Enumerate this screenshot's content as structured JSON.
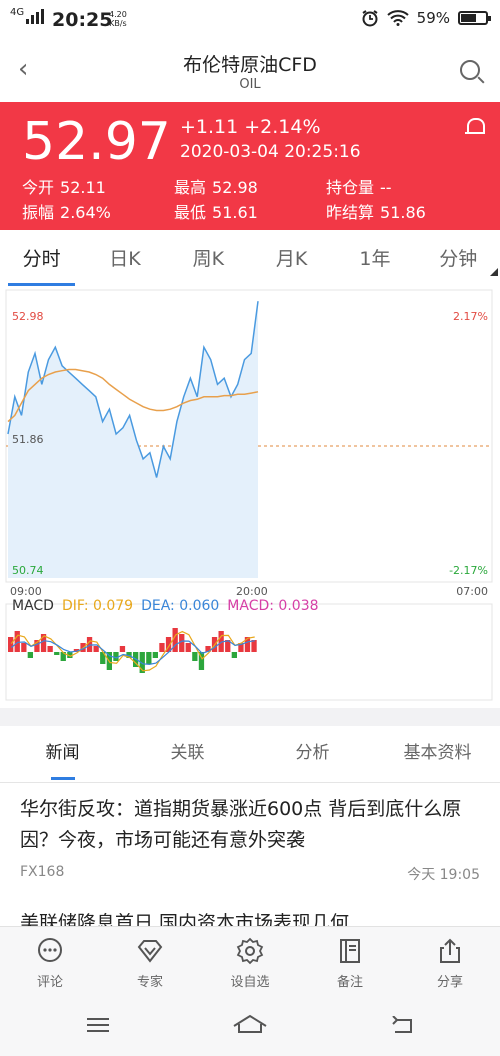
{
  "status_bar": {
    "network": "4G",
    "time": "20:25",
    "speed_value": "4.20",
    "speed_unit": "KB/s",
    "battery": "59%"
  },
  "header": {
    "title": "布伦特原油CFD",
    "subtitle": "OIL"
  },
  "quote": {
    "price": "52.97",
    "change": "+1.11 +2.14%",
    "datetime": "2020-03-04 20:25:16",
    "stats": [
      [
        {
          "label": "今开",
          "value": "52.11"
        },
        {
          "label": "最高",
          "value": "52.98"
        },
        {
          "label": "持仓量",
          "value": "--"
        }
      ],
      [
        {
          "label": "振幅",
          "value": "2.64%"
        },
        {
          "label": "最低",
          "value": "51.61"
        },
        {
          "label": "昨结算",
          "value": "51.86"
        }
      ]
    ],
    "up_color": "#f23846"
  },
  "period_tabs": [
    "分时",
    "日K",
    "周K",
    "月K",
    "1年",
    "分钟"
  ],
  "active_period": 0,
  "chart": {
    "price_top": "52.98",
    "price_mid": "51.86",
    "price_bottom": "50.74",
    "pct_top": "2.17%",
    "pct_bottom": "-2.17%",
    "time_start": "09:00",
    "time_mid": "20:00",
    "time_end": "07:00",
    "macd_title": "MACD",
    "dif": "DIF: 0.079",
    "dea": "DEA: 0.060",
    "macd": "MACD: 0.038",
    "line_color": "#4a9ae0",
    "avg_color": "#e8a04c"
  },
  "chart_data": {
    "type": "line",
    "ylim": [
      50.74,
      52.98
    ],
    "price": [
      51.9,
      52.2,
      52.05,
      52.4,
      52.55,
      52.3,
      52.5,
      52.6,
      52.45,
      52.4,
      52.35,
      52.3,
      52.25,
      52.2,
      52.0,
      52.1,
      51.9,
      51.95,
      52.05,
      51.85,
      51.7,
      51.75,
      51.55,
      51.8,
      51.7,
      52.0,
      52.2,
      52.35,
      52.2,
      52.6,
      52.5,
      52.3,
      52.35,
      52.2,
      52.3,
      52.5,
      52.55,
      52.97
    ],
    "average": [
      52.0,
      52.05,
      52.15,
      52.25,
      52.3,
      52.35,
      52.38,
      52.4,
      52.41,
      52.42,
      52.42,
      52.41,
      52.4,
      52.38,
      52.35,
      52.3,
      52.26,
      52.22,
      52.18,
      52.15,
      52.12,
      52.1,
      52.09,
      52.09,
      52.1,
      52.12,
      52.15,
      52.17,
      52.18,
      52.2,
      52.2,
      52.2,
      52.21,
      52.21,
      52.22,
      52.22,
      52.23,
      52.24
    ],
    "macd_hist": [
      0.05,
      0.07,
      0.03,
      -0.02,
      0.04,
      0.06,
      0.02,
      -0.01,
      -0.03,
      -0.02,
      0.01,
      0.03,
      0.05,
      0.02,
      -0.04,
      -0.06,
      -0.03,
      0.02,
      -0.02,
      -0.05,
      -0.07,
      -0.04,
      -0.02,
      0.03,
      0.05,
      0.08,
      0.06,
      0.03,
      -0.03,
      -0.06,
      0.02,
      0.05,
      0.07,
      0.04,
      -0.02,
      0.03,
      0.05,
      0.04
    ]
  },
  "news_tabs": [
    "新闻",
    "关联",
    "分析",
    "基本资料"
  ],
  "active_news_tab": 0,
  "news": [
    {
      "title": "华尔街反攻：道指期货暴涨近600点 背后到底什么原因？今夜，市场可能还有意外突袭",
      "source": "FX168",
      "time": "今天 19:05"
    }
  ],
  "news_cut_title": "美联储降息首日 国内资本市场表现几何",
  "toolbar": [
    "评论",
    "专家",
    "设自选",
    "备注",
    "分享"
  ]
}
